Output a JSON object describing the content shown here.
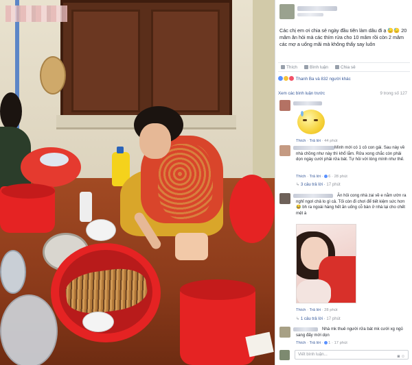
{
  "post": {
    "text": "Các chị em ơi chia sẻ ngày đầu tiên làm dâu đi ạ 😓😓 20 mâm ăn hỏi mà các thím rửa cho 10 mâm rồi còn 2 mâm các mợ a uống mãi mà không thấy say luôn",
    "actions": {
      "like": "Thích",
      "comment": "Bình luận",
      "share": "Chia sẻ"
    },
    "likes_text": "Thanh Ba và 832 người khác",
    "view_previous": "Xem các bình luận trước",
    "comment_count": "9 trong số 127"
  },
  "comments": [
    {
      "meta_like": "Thích",
      "meta_reply": "Trả lời",
      "time": "44 phút"
    },
    {
      "text": "Mình mới có 1 cô con gái. Sau này về nhà chồng như này thì khổ lắm. Rửa xong chắc còn phải dọn ngày cưới phải rửa bát. Tự hỏi với lòng mình như thế.",
      "meta_like": "Thích",
      "meta_reply": "Trả lời",
      "likes": "6",
      "time": "28 phút",
      "replies": "3 câu trả lời",
      "replies_time": "17 phút"
    },
    {
      "text": "Ăn hỏi cong nhà zai về e nằm ườn ra nghỉ ngơi chả lo gì cả. Tối còn đi chơi để tiết kiệm sức hơn 😂 bh ra ngoài hàng hết ăn uống cỗ bàn ở nhà lại cho chết mệt à",
      "meta_like": "Thích",
      "meta_reply": "Trả lời",
      "time": "28 phút",
      "replies": "1 câu trả lời",
      "replies_time": "17 phút"
    },
    {
      "text": "Nhà mk thuê người rửa bát mk cưới xg ngủ sang đấy mới dọn",
      "meta_like": "Thích",
      "meta_reply": "Trả lời",
      "likes": "1",
      "time": "17 phút"
    }
  ],
  "write_placeholder": "Viết bình luận...",
  "colors": {
    "fb_link": "#365899",
    "meta_grey": "#90949c",
    "bucket_red": "#e52323",
    "like_blue": "#5890ff"
  },
  "icons": [
    "like-icon",
    "comment-icon",
    "share-icon",
    "camera-icon",
    "sticker-icon"
  ]
}
